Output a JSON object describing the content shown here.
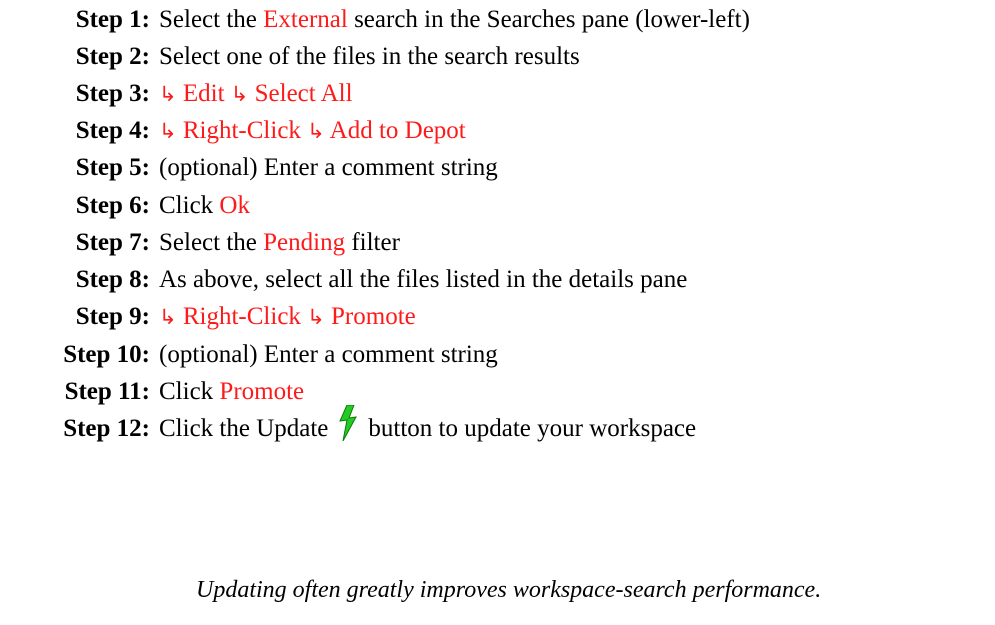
{
  "steps": [
    {
      "label": "Step 1:",
      "parts": [
        {
          "t": "Select the "
        },
        {
          "t": "External",
          "c": "red"
        },
        {
          "t": " search in the Searches pane (lower-left)"
        }
      ]
    },
    {
      "label": "Step 2:",
      "parts": [
        {
          "t": "Select one of the files in the search results"
        }
      ]
    },
    {
      "label": "Step 3:",
      "parts": [
        {
          "arrow": true
        },
        {
          "t": " Edit ",
          "c": "red"
        },
        {
          "arrow": true
        },
        {
          "t": " Select All",
          "c": "red"
        }
      ]
    },
    {
      "label": "Step 4:",
      "parts": [
        {
          "arrow": true
        },
        {
          "t": " Right-Click ",
          "c": "red"
        },
        {
          "arrow": true
        },
        {
          "t": " Add to Depot",
          "c": "red"
        }
      ]
    },
    {
      "label": "Step 5:",
      "parts": [
        {
          "t": "(optional) Enter a comment string"
        }
      ]
    },
    {
      "label": "Step 6:",
      "parts": [
        {
          "t": "Click "
        },
        {
          "t": "Ok",
          "c": "red"
        }
      ]
    },
    {
      "label": "Step 7:",
      "parts": [
        {
          "t": "Select the "
        },
        {
          "t": "Pending",
          "c": "red"
        },
        {
          "t": " filter"
        }
      ]
    },
    {
      "label": "Step 8:",
      "parts": [
        {
          "t": "As above, select all the files listed in the details pane"
        }
      ]
    },
    {
      "label": "Step 9:",
      "parts": [
        {
          "arrow": true
        },
        {
          "t": " Right-Click ",
          "c": "red"
        },
        {
          "arrow": true
        },
        {
          "t": " Promote",
          "c": "red"
        }
      ]
    },
    {
      "label": "Step 10:",
      "parts": [
        {
          "t": "(optional) Enter a comment string"
        }
      ]
    },
    {
      "label": "Step 11:",
      "parts": [
        {
          "t": "Click "
        },
        {
          "t": "Promote",
          "c": "red"
        }
      ]
    },
    {
      "label": "Step 12:",
      "parts": [
        {
          "t": "Click the Update"
        },
        {
          "icon": "lightning-bolt-icon"
        },
        {
          "t": "button to update your workspace"
        }
      ]
    }
  ],
  "arrow_glyph": "↳",
  "note": "Updating often greatly improves workspace-search performance.",
  "colors": {
    "highlight": "#ff1a1a",
    "text": "#000000",
    "icon_green": "#22cc22"
  }
}
